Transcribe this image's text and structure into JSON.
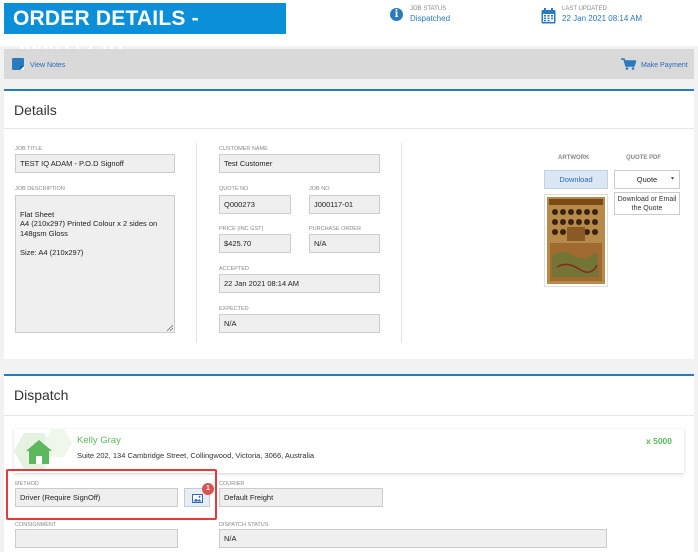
{
  "header": {
    "title": "ORDER DETAILS - J000117-01",
    "job_status": {
      "label": "JOB STATUS",
      "value": "Dispatched"
    },
    "last_updated": {
      "label": "LAST UPDATED",
      "value": "22 Jan 2021 08:14 AM"
    }
  },
  "toolbar": {
    "view_notes": "View Notes",
    "make_payment": "Make Payment"
  },
  "details": {
    "heading": "Details",
    "job_title": {
      "label": "JOB TITLE",
      "value": "TEST IQ ADAM - P.O.D Signoff"
    },
    "job_description": {
      "label": "JOB DESCRIPTION",
      "value": "Flat Sheet\nA4 (210x297)  Printed Colour x 2 sides  on 148gsm Gloss\n\nSize: A4 (210x297)"
    },
    "customer_name": {
      "label": "CUSTOMER NAME",
      "value": "Test Customer"
    },
    "quote_no": {
      "label": "QUOTE NO",
      "value": "Q000273"
    },
    "job_no": {
      "label": "JOB NO",
      "value": "J000117-01"
    },
    "price": {
      "label": "PRICE (INC GST)",
      "value": "$425.70"
    },
    "purchase_order": {
      "label": "PURCHASE ORDER",
      "value": "N/A"
    },
    "accepted": {
      "label": "ACCEPTED",
      "value": "22 Jan 2021 08:14 AM"
    },
    "expected": {
      "label": "EXPECTED",
      "value": "N/A"
    },
    "artwork": {
      "heading": "ARTWORK",
      "download_label": "Download"
    },
    "quote_pdf": {
      "heading": "QUOTE PDF",
      "selected": "Quote",
      "alt_text": "Download or Email the Quote"
    }
  },
  "dispatch": {
    "heading": "Dispatch",
    "customer": {
      "name": "Kelly Gray",
      "address": "Suite 202, 134 Cambridge Street, Collingwood, Victoria, 3066, Australia",
      "quantity": "x 5000"
    },
    "method": {
      "label": "METHOD",
      "value": "Driver (Require SignOff)"
    },
    "badge_count": "1",
    "courier": {
      "label": "COURIER",
      "value": "Default Freight"
    },
    "consignment": {
      "label": "CONSIGNMENT",
      "value": ""
    },
    "dispatch_status": {
      "label": "DISPATCH STATUS",
      "value": "N/A"
    }
  },
  "colors": {
    "title_bg": "#0b8fd9",
    "accent": "#2a7ac0",
    "customer_green": "#5cb85c",
    "highlight_red": "#e03c3c"
  },
  "icons": {
    "status": "info-circle-icon",
    "updated": "calendar-icon",
    "notes": "notes-icon",
    "payment": "shopping-cart-icon",
    "address": "house-icon",
    "method_image": "image-icon"
  }
}
